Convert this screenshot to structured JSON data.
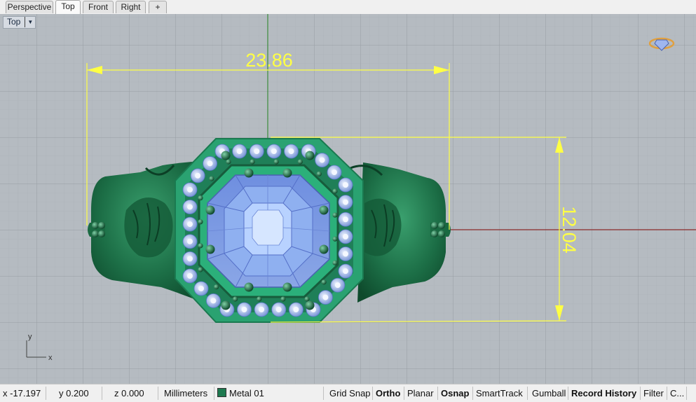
{
  "tabs": [
    {
      "label": "Perspective"
    },
    {
      "label": "Top"
    },
    {
      "label": "Front"
    },
    {
      "label": "Right"
    },
    {
      "label": "+"
    }
  ],
  "viewport": {
    "name": "Top"
  },
  "dimensions": {
    "horizontal": "23.86",
    "vertical": "12.04"
  },
  "axis": {
    "x": "x",
    "y": "y"
  },
  "status": {
    "x": "x -17.197",
    "y": "y 0.200",
    "z": "z 0.000",
    "units": "Millimeters",
    "layer": "Metal 01",
    "layer_color": "#1e7a50",
    "buttons": [
      "Grid Snap",
      "Ortho",
      "Planar",
      "Osnap",
      "SmartTrack",
      "Gumball",
      "Record History",
      "Filter",
      "C..."
    ]
  }
}
